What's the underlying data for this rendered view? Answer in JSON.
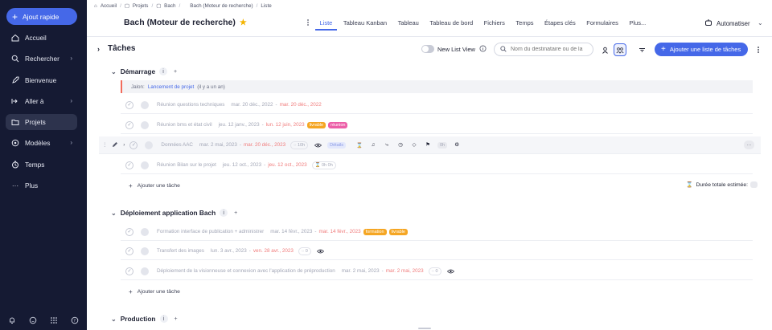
{
  "sidebar": {
    "quick_add": "Ajout rapide",
    "items": [
      {
        "label": "Accueil",
        "icon": "home-icon"
      },
      {
        "label": "Rechercher",
        "icon": "search-icon",
        "chevron": true
      },
      {
        "label": "Bienvenue",
        "icon": "rocket-icon"
      },
      {
        "label": "Aller à",
        "icon": "goto-icon",
        "chevron": true
      },
      {
        "label": "Projets",
        "icon": "folder-icon",
        "active": true
      },
      {
        "label": "Modèles",
        "icon": "templates-icon",
        "chevron": true
      },
      {
        "label": "Temps",
        "icon": "clock-icon"
      },
      {
        "label": "Plus",
        "icon": "more-icon"
      }
    ],
    "bottom_icons": [
      "bell-icon",
      "emoji-icon",
      "apps-grid-icon",
      "help-icon"
    ]
  },
  "breadcrumb": [
    "Accueil",
    "Projets",
    "Bach",
    "Bach (Moteur de recherche)",
    "Liste"
  ],
  "header": {
    "title": "Bach (Moteur de recherche)",
    "tabs": [
      "Liste",
      "Tableau Kanban",
      "Tableau",
      "Tableau de bord",
      "Fichiers",
      "Temps",
      "Étapes clés",
      "Formulaires",
      "Plus..."
    ],
    "active_tab": "Liste",
    "automate": "Automatiser"
  },
  "toolbar": {
    "title": "Tâches",
    "new_list_view": "New List View",
    "search_placeholder": "Nom du destinataire ou de la",
    "add_list": "Ajouter une liste de tâches"
  },
  "groups": [
    {
      "name": "Démarrage",
      "count": "i",
      "milestone": {
        "prefix": "Jalon:",
        "link": "Lancement de projet",
        "suffix": "(il y a un an)"
      },
      "tasks": [
        {
          "name": "Réunion questions techniques",
          "start": "mar. 20 déc., 2022",
          "end": "mar. 20 déc., 2022"
        },
        {
          "name": "Réunion bms et état civil",
          "start": "jeu. 12 janv., 2023",
          "end": "lun. 12 juin, 2023",
          "tags": [
            "livrable",
            "réunion"
          ]
        },
        {
          "name": "Données AAC",
          "start": "mar. 2 mai, 2023",
          "end": "mar. 20 déc., 2023",
          "comments": "10h",
          "status_tag": "Détails",
          "time_chip": "0h",
          "more": "···"
        },
        {
          "name": "Réunion Bilan sur le projet",
          "start": "jeu. 12 oct., 2023",
          "end": "jeu. 12 oct., 2023",
          "time_chip": "0h 0h"
        }
      ],
      "add_task": "Ajouter une tâche",
      "duration_label": "Durée totale estimée:"
    },
    {
      "name": "Déploiement application Bach",
      "count": "i",
      "tasks": [
        {
          "name": "Formation interface de publication + administrer",
          "start": "mar. 14 févr., 2023",
          "end": "mar. 14 févr., 2023",
          "tags": [
            "formation",
            "livrable"
          ]
        },
        {
          "name": "Transfert des images",
          "start": "lun. 3 avr., 2023",
          "end": "ven. 28 avr., 2023",
          "comments": "0"
        },
        {
          "name": "Déploiement de la visionneuse et connexion avec l'application de préproduction",
          "start": "mar. 2 mai, 2023",
          "end": "mar. 2 mai, 2023",
          "comments": "0"
        }
      ],
      "add_task": "Ajouter une tâche"
    },
    {
      "name": "Production",
      "count": "i"
    }
  ],
  "colors": {
    "accent": "#4568e8",
    "sidebar": "#151a33",
    "overdue": "#f07b7b",
    "milestone_bar": "#f26b5b",
    "tag_orange": "#f5a623",
    "tag_pink": "#ec5fa8"
  }
}
